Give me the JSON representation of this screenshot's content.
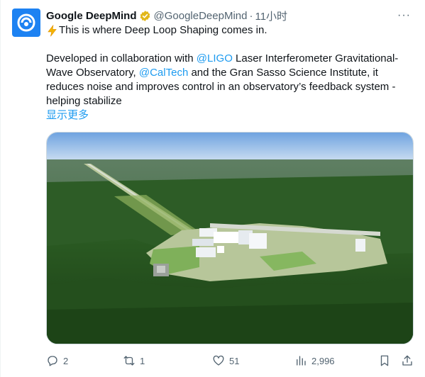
{
  "tweet": {
    "author_name": "Google DeepMind",
    "author_handle": "@GoogleDeepMind",
    "separator": "·",
    "time": "11小时",
    "more_label": "···",
    "line1": "This is where Deep Loop Shaping comes in.",
    "body": {
      "t1": "Developed in collaboration with ",
      "m1": "@LIGO",
      "t2": " Laser Interferometer Gravitational-Wave Observatory, ",
      "m2": "@CalTech",
      "t3": " and the Gran Sasso Science Institute, it reduces noise and improves control in an observatory’s feedback system - helping stabilize"
    },
    "show_more": "显示更多"
  },
  "actions": {
    "replies": "2",
    "reposts": "1",
    "likes": "51",
    "views": "2,996"
  },
  "colors": {
    "accent": "#1d9bf0",
    "avatar_bg": "#1d82f2",
    "verified_gold": "#e2b719",
    "muted": "#536471"
  },
  "icons": [
    "deepmind-logo-icon",
    "verified-badge-icon",
    "lightning-icon",
    "more-icon",
    "reply-icon",
    "repost-icon",
    "like-icon",
    "views-icon",
    "bookmark-icon",
    "share-icon"
  ]
}
